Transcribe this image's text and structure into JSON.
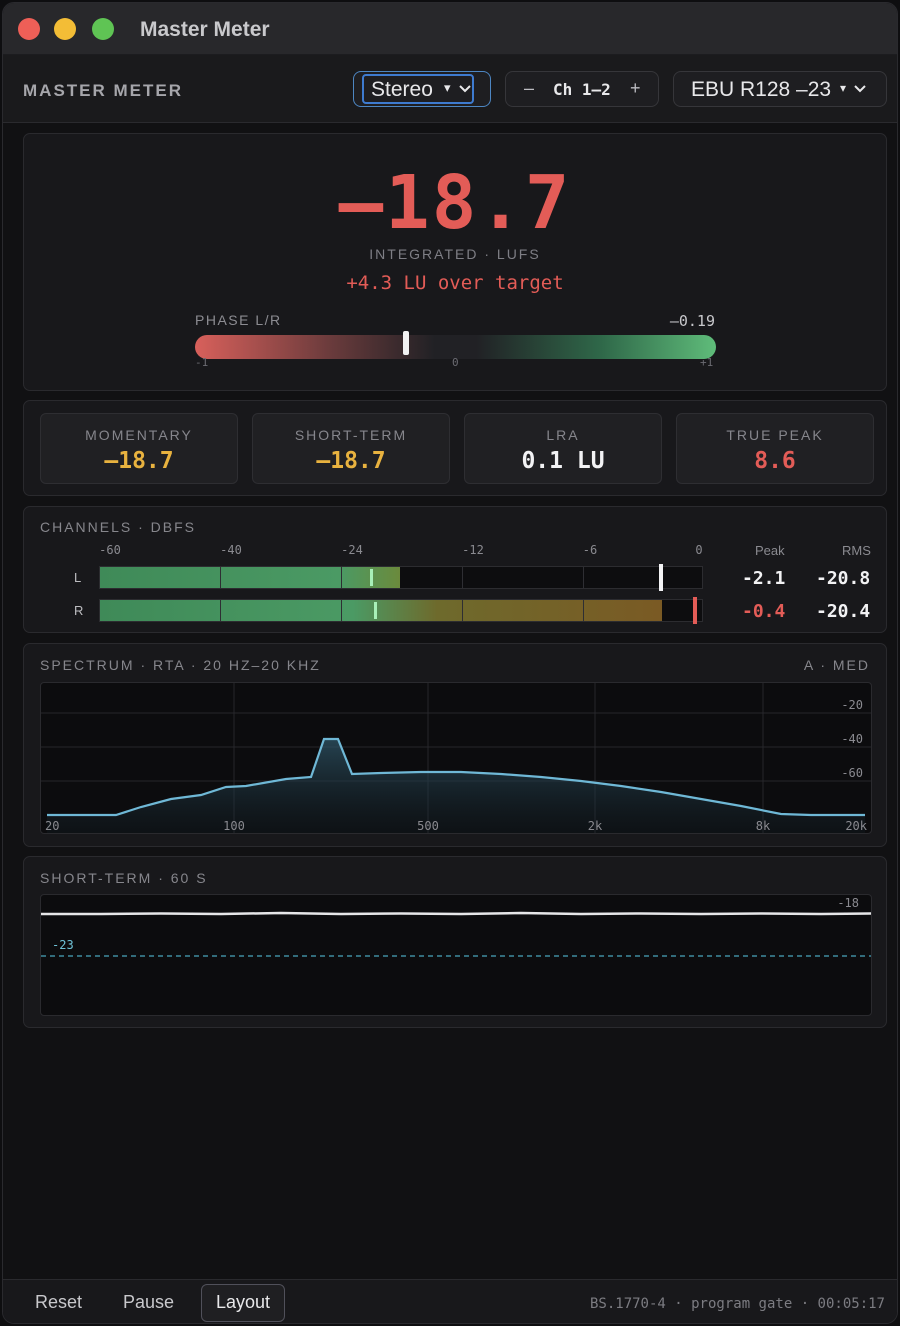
{
  "window": {
    "title": "Master Meter"
  },
  "toolbar": {
    "app_label": "MASTER METER",
    "mode_value": "Stereo",
    "channel_label": "Ch 1–2",
    "channel_minus": "–",
    "channel_plus": "+",
    "standard_value": "EBU R128 –23",
    "caret": "▾"
  },
  "loudness": {
    "integrated_value": "–18.7",
    "integrated_label": "INTEGRATED · LUFS",
    "over_target": "+4.3 LU over target",
    "phase_label": "PHASE L/R",
    "phase_value": "–0.19",
    "phase_correlation": -0.19,
    "phase_min": "-1",
    "phase_mid": "0",
    "phase_max": "+1"
  },
  "stats": [
    {
      "label": "MOMENTARY",
      "value": "–18.7",
      "color": "#e8b23f"
    },
    {
      "label": "SHORT-TERM",
      "value": "–18.7",
      "color": "#e8b23f"
    },
    {
      "label": "LRA",
      "value": "0.1 LU",
      "color": "#f2f2f4"
    },
    {
      "label": "TRUE PEAK",
      "value": "8.6",
      "color": "#e35c57"
    }
  ],
  "channels": {
    "title": "CHANNELS · DBFS",
    "scale": [
      "-60",
      "-40",
      "-24",
      "-12",
      "-6",
      "0"
    ],
    "peak_header": "Peak",
    "rms_header": "RMS",
    "rows": [
      {
        "name": "L",
        "peak": "-2.1",
        "rms": "-20.8",
        "peak_color": "#f2f2f4"
      },
      {
        "name": "R",
        "peak": "-0.4",
        "rms": "-20.4",
        "peak_color": "#e35c57"
      }
    ]
  },
  "spectrum": {
    "title": "SPECTRUM · RTA · 20 HZ–20 KHZ",
    "mode": "A · MED",
    "x_ticks": [
      "20",
      "100",
      "500",
      "2k",
      "8k",
      "20k"
    ],
    "y_ticks": [
      "-20",
      "-40",
      "-60"
    ]
  },
  "shortterm": {
    "title": "SHORT-TERM · 60 S",
    "top_label": "-18",
    "target_label": "-23"
  },
  "footer": {
    "reset": "Reset",
    "pause": "Pause",
    "layout": "Layout",
    "status": "BS.1770-4 · program gate · 00:05:17"
  },
  "colors": {
    "accent_red": "#e35c57",
    "accent_amber": "#e8b23f",
    "meter_green": "#4b9a64",
    "spectrum_line": "#6fb8d6",
    "target_line": "#4aa6bd"
  }
}
